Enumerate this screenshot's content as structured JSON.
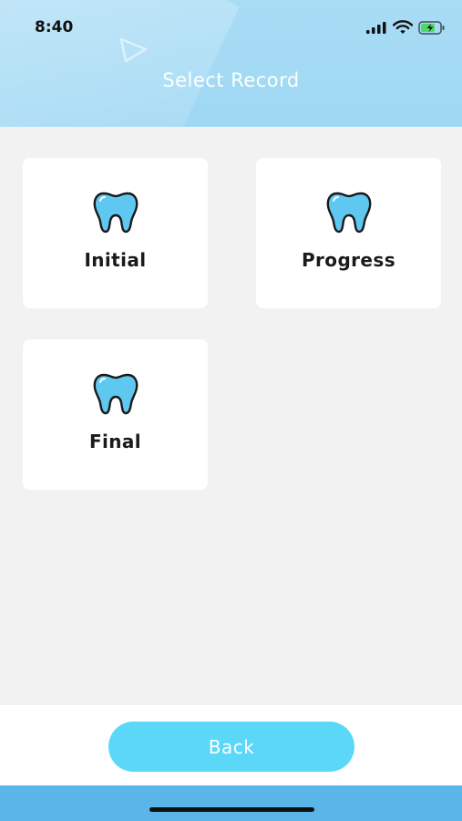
{
  "status_bar": {
    "time": "8:40"
  },
  "header": {
    "title": "Select Record"
  },
  "records": [
    {
      "label": "Initial",
      "icon": "tooth-icon"
    },
    {
      "label": "Progress",
      "icon": "tooth-icon"
    },
    {
      "label": "Final",
      "icon": "tooth-icon"
    }
  ],
  "footer": {
    "back_label": "Back"
  },
  "colors": {
    "header": "#a9dcf5",
    "tooth_fill": "#5ec8f0",
    "button": "#5bd8f8",
    "home_bar_bg": "#5ab6e8"
  }
}
